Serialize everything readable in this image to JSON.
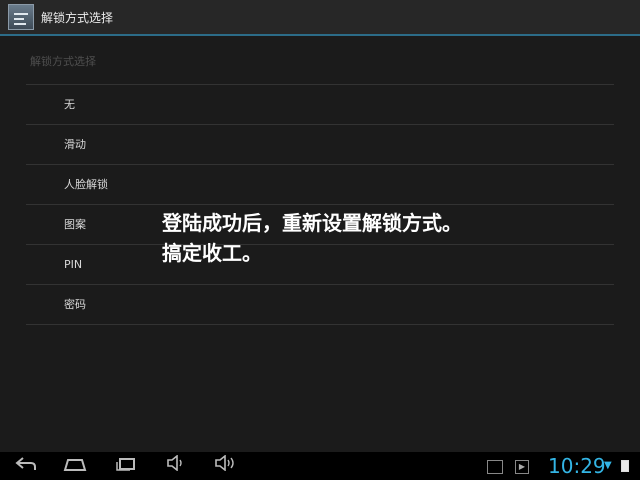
{
  "header": {
    "title": "解锁方式选择",
    "icon": "settings-app-icon"
  },
  "list": {
    "section_title": "解锁方式选择",
    "items": [
      "无",
      "滑动",
      "人脸解锁",
      "图案",
      "PIN",
      "密码"
    ]
  },
  "overlay_caption": {
    "line1": "登陆成功后，重新设置解锁方式。",
    "line2": "搞定收工。"
  },
  "navbar": {
    "buttons": [
      "back-icon",
      "home-icon",
      "recents-icon",
      "volume-down-icon",
      "volume-up-icon"
    ],
    "status_icons": [
      "gallery-icon",
      "play-store-icon",
      "wifi-icon",
      "battery-icon"
    ],
    "clock": "10:29"
  },
  "colors": {
    "accent": "#33b5e5",
    "divider": "#2c6c88"
  }
}
